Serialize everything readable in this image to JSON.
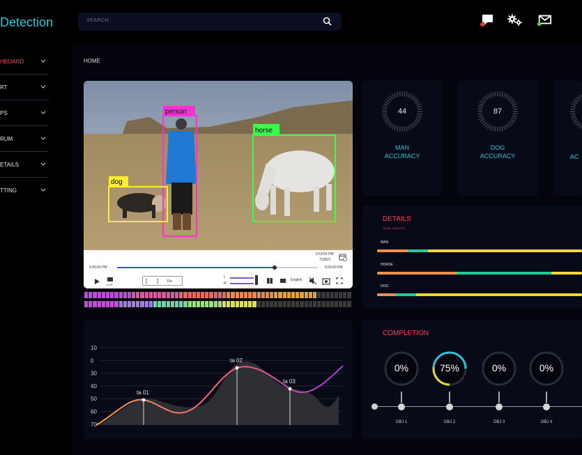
{
  "header": {
    "brand": "Detection",
    "search_placeholder": "SEARCH",
    "icons": [
      "chat-icon",
      "gears-icon",
      "mail-icon"
    ]
  },
  "sidebar": {
    "items": [
      {
        "label": "HBOARD",
        "active": true
      },
      {
        "label": "RT",
        "active": false
      },
      {
        "label": "PS",
        "active": false
      },
      {
        "label": "RUM",
        "active": false
      },
      {
        "label": "ETAILS",
        "active": false
      },
      {
        "label": "TTING",
        "active": false
      }
    ]
  },
  "breadcrumb": "HOME",
  "video": {
    "detections": [
      "person",
      "horse",
      "dog"
    ],
    "time_left": "5:49:00 PM",
    "time_top": "5:53:54 PM",
    "date": "7/28/21",
    "time_right": "5:54:00 PM",
    "live": "LIVE",
    "bracket_open": "[",
    "bracket_close": "]",
    "speed": "10x",
    "lane_l": "L",
    "lane_r": "R",
    "language": "English"
  },
  "accuracy": [
    {
      "value": "44",
      "label_line1": "MAN",
      "label_line2": "ACCURACY"
    },
    {
      "value": "87",
      "label_line1": "DOG",
      "label_line2": "ACCURACY"
    },
    {
      "value": "",
      "label_line1": "",
      "label_line2": "AC"
    }
  ],
  "details": {
    "title": "DETAILS",
    "subtitle": "TOTAL OBJECTS",
    "rows": [
      {
        "label": "MAN",
        "orange": 0.15,
        "teal": 0.1
      },
      {
        "label": "HORSE",
        "orange": 0.39,
        "teal": 0.46
      },
      {
        "label": "DOG",
        "orange": 0.09,
        "teal": 0.1
      }
    ]
  },
  "completion": {
    "title": "COMPLETION",
    "items": [
      {
        "value": "0%",
        "fraction": 0,
        "label": "OBJ 1"
      },
      {
        "value": "75%",
        "fraction": 0.75,
        "label": "OBJ 2"
      },
      {
        "value": "0%",
        "fraction": 0,
        "label": "OBJ 3"
      },
      {
        "value": "0%",
        "fraction": 0,
        "label": "OBJ 4"
      }
    ]
  },
  "chart_data": {
    "type": "area",
    "y_ticks": [
      "10",
      "0",
      "30",
      "40",
      "50",
      "60",
      "70"
    ],
    "annotations": [
      "ta 01",
      "ta 02",
      "ta 03"
    ]
  }
}
